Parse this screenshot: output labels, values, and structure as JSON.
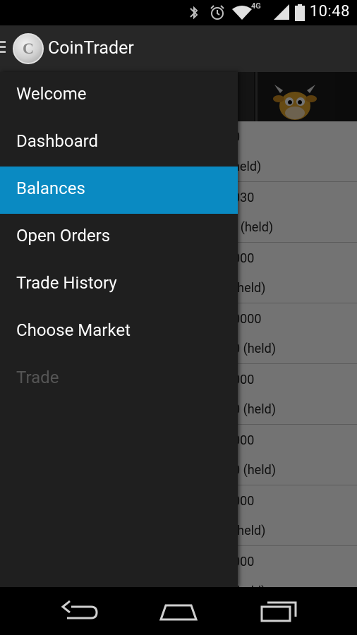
{
  "status_bar": {
    "time": "10:48",
    "network_label": "4G",
    "icons": [
      "bluetooth-icon",
      "alarm-icon",
      "wifi-icon",
      "signal-icon",
      "battery-icon"
    ]
  },
  "action_bar": {
    "app_title": "CoinTrader",
    "logo_glyph": "C"
  },
  "drawer": {
    "items": [
      {
        "label": "Welcome",
        "selected": false,
        "enabled": true
      },
      {
        "label": "Dashboard",
        "selected": false,
        "enabled": true
      },
      {
        "label": "Balances",
        "selected": true,
        "enabled": true
      },
      {
        "label": "Open Orders",
        "selected": false,
        "enabled": true
      },
      {
        "label": "Trade History",
        "selected": false,
        "enabled": true
      },
      {
        "label": "Choose Market",
        "selected": false,
        "enabled": true
      },
      {
        "label": "Trade",
        "selected": false,
        "enabled": false
      }
    ]
  },
  "background_list": {
    "rows": [
      {
        "amount": "0",
        "held": "held)"
      },
      {
        "amount": "030",
        "held": ") (held)"
      },
      {
        "amount": "000",
        "held": " (held)"
      },
      {
        "amount": "0000",
        "held": "0 (held)"
      },
      {
        "amount": "000",
        "held": "0 (held)"
      },
      {
        "amount": "000",
        "held": "0 (held)"
      },
      {
        "amount": "000",
        "held": " (held)"
      },
      {
        "amount": "000",
        "held": "(held)"
      }
    ]
  },
  "colors": {
    "accent": "#0a8ac2",
    "drawer_bg": "#1f1f1f",
    "action_bar_bg": "#272727"
  }
}
